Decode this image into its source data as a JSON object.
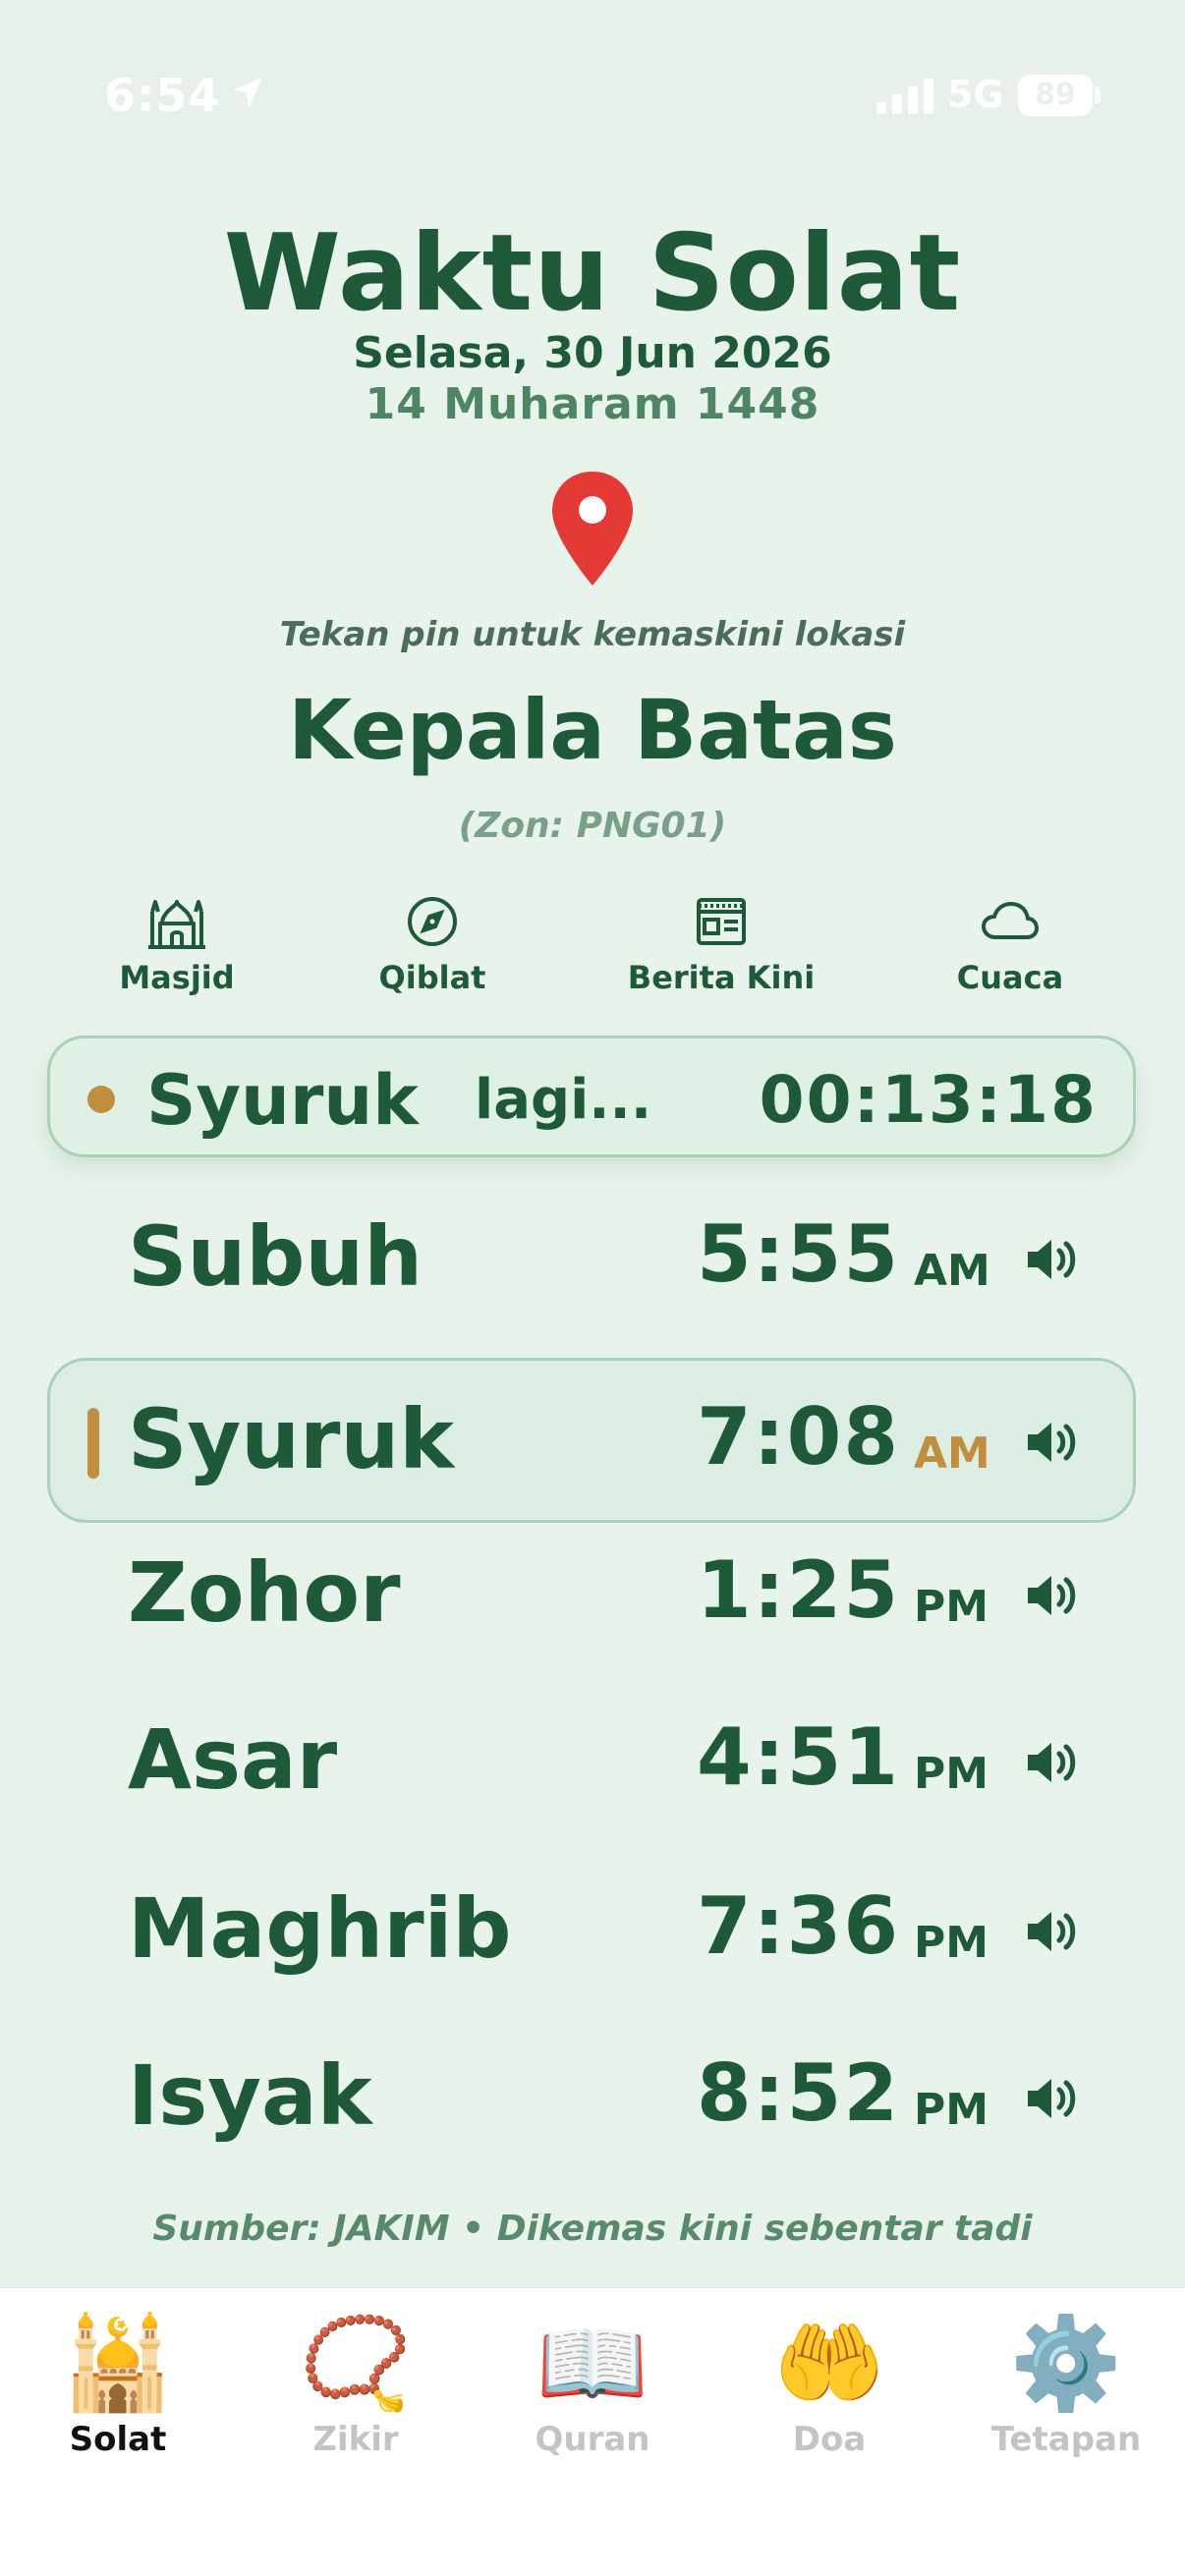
{
  "status": {
    "time": "6:54",
    "network": "5G",
    "battery": "89"
  },
  "header": {
    "title": "Waktu Solat",
    "gregorian_date": "Selasa, 30 Jun 2026",
    "hijri_date": "14 Muharam 1448"
  },
  "location": {
    "hint": "Tekan pin untuk kemaskini lokasi",
    "name": "Kepala Batas",
    "zone": "(Zon: PNG01)"
  },
  "quick_actions": [
    {
      "label": "Masjid",
      "icon": "mosque-icon"
    },
    {
      "label": "Qiblat",
      "icon": "compass-icon"
    },
    {
      "label": "Berita Kini",
      "icon": "newspaper-icon"
    },
    {
      "label": "Cuaca",
      "icon": "cloud-icon"
    }
  ],
  "countdown": {
    "prayer": "Syuruk",
    "label": "lagi...",
    "timer": "00:13:18"
  },
  "prayers": [
    {
      "name": "Subuh",
      "time": "5:55",
      "ampm": "AM",
      "active": false
    },
    {
      "name": "Syuruk",
      "time": "7:08",
      "ampm": "AM",
      "active": true
    },
    {
      "name": "Zohor",
      "time": "1:25",
      "ampm": "PM",
      "active": false
    },
    {
      "name": "Asar",
      "time": "4:51",
      "ampm": "PM",
      "active": false
    },
    {
      "name": "Maghrib",
      "time": "7:36",
      "ampm": "PM",
      "active": false
    },
    {
      "name": "Isyak",
      "time": "8:52",
      "ampm": "PM",
      "active": false
    }
  ],
  "source_note": "Sumber: JAKIM • Dikemas kini sebentar tadi",
  "tabs": [
    {
      "label": "Solat",
      "icon": "mosque-emoji-icon",
      "glyph": "🕌",
      "selected": true
    },
    {
      "label": "Zikir",
      "icon": "prayer-beads-icon",
      "glyph": "📿",
      "selected": false
    },
    {
      "label": "Quran",
      "icon": "open-book-icon",
      "glyph": "📖",
      "selected": false
    },
    {
      "label": "Doa",
      "icon": "palms-up-icon",
      "glyph": "🤲",
      "selected": false
    },
    {
      "label": "Tetapan",
      "icon": "gear-icon",
      "glyph": "⚙️",
      "selected": false
    }
  ],
  "colors": {
    "primary": "#1e5a3a",
    "accent": "#bf8e3f",
    "background": "#e8f3eb",
    "pin": "#e53935"
  }
}
